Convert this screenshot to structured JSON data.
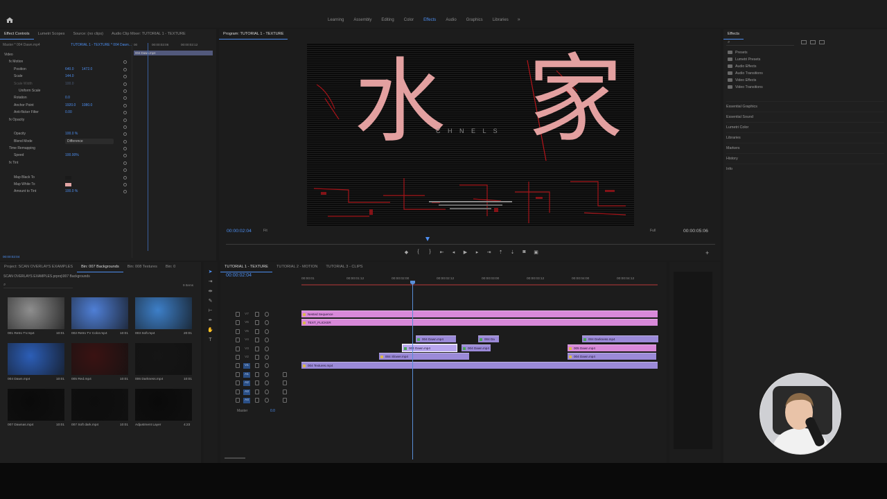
{
  "workspaces": [
    "Learning",
    "Assembly",
    "Editing",
    "Color",
    "Effects",
    "Audio",
    "Graphics",
    "Libraries"
  ],
  "workspace_active": "Effects",
  "top_left_tabs": [
    {
      "label": "Effect Controls",
      "active": true
    },
    {
      "label": "Lumetri Scopes",
      "active": false
    },
    {
      "label": "Source: (no clips)",
      "active": false
    },
    {
      "label": "Audio Clip Mixer: TUTORIAL 1 - TEXTURE",
      "active": false
    }
  ],
  "effect_controls": {
    "master": "Master * 004 Dawn.mp4",
    "sequence": "TUTORIAL 1 - TEXTURE * 004 Dawn...",
    "ruler": [
      "00",
      "00:00:02:06",
      "00:00:02:12"
    ],
    "clip_name": "004 Dawn.mp4",
    "rows": [
      {
        "label": "Video",
        "indent": 0
      },
      {
        "label": "fx  Motion",
        "indent": 1
      },
      {
        "label": "Position",
        "indent": 2,
        "v1": "640.0",
        "v2": "1472.0"
      },
      {
        "label": "Scale",
        "indent": 2,
        "v1": "144.0"
      },
      {
        "label": "Scale Width",
        "indent": 2,
        "v1": "100.0",
        "dim": true
      },
      {
        "label": "Uniform Scale",
        "indent": 3
      },
      {
        "label": "Rotation",
        "indent": 2,
        "v1": "0.0"
      },
      {
        "label": "Anchor Point",
        "indent": 2,
        "v1": "1920.0",
        "v2": "1080.0"
      },
      {
        "label": "Anti-flicker Filter",
        "indent": 2,
        "v1": "0.00"
      },
      {
        "label": "fx  Opacity",
        "indent": 1
      },
      {
        "label": "",
        "indent": 2
      },
      {
        "label": "Opacity",
        "indent": 2,
        "v1": "100.0 %"
      },
      {
        "label": "Blend Mode",
        "indent": 2,
        "dropdown": "Difference"
      },
      {
        "label": "Time Remapping",
        "indent": 1
      },
      {
        "label": "Speed",
        "indent": 2,
        "v1": "100.00%"
      },
      {
        "label": "fx  Tint",
        "indent": 1
      },
      {
        "label": "",
        "indent": 2
      },
      {
        "label": "Map Black To",
        "indent": 2,
        "swatch": "#1a1a1a"
      },
      {
        "label": "Map White To",
        "indent": 2,
        "swatch": "#e2a4a4"
      },
      {
        "label": "Amount to Tint",
        "indent": 2,
        "v1": "100.0 %"
      }
    ],
    "timecode": "00:00:02:04"
  },
  "program": {
    "tab": "Program: TUTORIAL 1 - TEXTURE",
    "timecode_left": "00:00:02:04",
    "fit": "Fit",
    "quality": "Full",
    "timecode_right": "00:00:05:06",
    "video_text": [
      "水",
      "家"
    ],
    "video_subtitle": "C H N E L S"
  },
  "effects_panel": {
    "tab": "Effects",
    "tree": [
      "Presets",
      "Lumetri Presets",
      "Audio Effects",
      "Audio Transitions",
      "Video Effects",
      "Video Transitions"
    ],
    "panels": [
      "Essential Graphics",
      "Essential Sound",
      "Lumetri Color",
      "Libraries",
      "Markers",
      "History",
      "Info"
    ]
  },
  "project": {
    "tabs": [
      {
        "label": "Project: SCAN OVERLAYS EXAMPLES",
        "active": false
      },
      {
        "label": "Bin: 007 Backgrounds",
        "active": true
      },
      {
        "label": "Bin: 008 Textures",
        "active": false
      },
      {
        "label": "Bin: 0",
        "active": false
      }
    ],
    "path": "SCAN OVERLAYS EXAMPLES.prproj\\007 Backgrounds",
    "item_count": "9 Items",
    "items": [
      {
        "name": "001 Retro TV.mp4",
        "dur": "10:01",
        "color": "#8e8e8e"
      },
      {
        "name": "002 Retro TV Color.mp4",
        "dur": "10:01",
        "color": "#4f7fd6"
      },
      {
        "name": "003 Soft.mp4",
        "dur": "20:01",
        "color": "#3d7fc8"
      },
      {
        "name": "004 Dawn.mp4",
        "dur": "10:01",
        "color": "#2c5eb7"
      },
      {
        "name": "005 Red.mp4",
        "dur": "10:01",
        "color": "#3a1212"
      },
      {
        "name": "006 Darkness.mp4",
        "dur": "10:01",
        "color": "#151515"
      },
      {
        "name": "007 Dawnas.mp4",
        "dur": "10:01",
        "color": "#0a0a0a"
      },
      {
        "name": "007 Soft dark.mp4",
        "dur": "10:01",
        "color": "#0d0d0d"
      },
      {
        "name": "Adjustment Layer",
        "dur": "4:23",
        "color": "#0a0a0a"
      }
    ]
  },
  "timeline": {
    "tabs": [
      {
        "label": "TUTORIAL 1 - TEXTURE",
        "active": true
      },
      {
        "label": "TUTORIAL 2 - MOTION",
        "active": false
      },
      {
        "label": "TUTORIAL 3 - CLIPS",
        "active": false
      }
    ],
    "timecode": "00:00:02:04",
    "ruler": [
      "00:00:01",
      "00:00:01:12",
      "00:00:02:00",
      "00:00:02:12",
      "00:00:03:00",
      "00:00:03:12",
      "00:00:04:00",
      "00:00:04:12"
    ],
    "video_tracks": [
      "V7",
      "V6",
      "V5",
      "V4",
      "V3",
      "V2",
      "V1"
    ],
    "audio_tracks": [
      "A1",
      "A2",
      "A3",
      "A4"
    ],
    "master": "Master",
    "master_value": "0.0",
    "clips": [
      {
        "name": "Nested Sequence",
        "color": "pink"
      },
      {
        "name": "TEXT_FLICKER",
        "color": "pink"
      },
      {
        "name": "004 Dawn.mp4",
        "color": "purple"
      },
      {
        "name": "004 Da",
        "color": "purple"
      },
      {
        "name": "004 Darkness.mp4",
        "color": "purple"
      },
      {
        "name": "004 Dawn.mp4",
        "color": "sel"
      },
      {
        "name": "004 Dawn.mp4",
        "color": "purple"
      },
      {
        "name": "005 Dawn.mp4",
        "color": "pink"
      },
      {
        "name": "004 Slower.mp4",
        "color": "purple"
      },
      {
        "name": "004 Dawn.mp4",
        "color": "purple"
      },
      {
        "name": "004 Textures.mp4",
        "color": "purple"
      }
    ]
  },
  "colors": {
    "accent": "#4d8ff2",
    "clip_pink": "#d889d9",
    "clip_purple": "#9b8ad8",
    "tint_text": "#e3a0a0",
    "red_grunge": "#b5141a"
  },
  "icons": [
    "home-icon",
    "more-workspaces-icon",
    "search-icon",
    "play-icon",
    "add-button-icon"
  ]
}
